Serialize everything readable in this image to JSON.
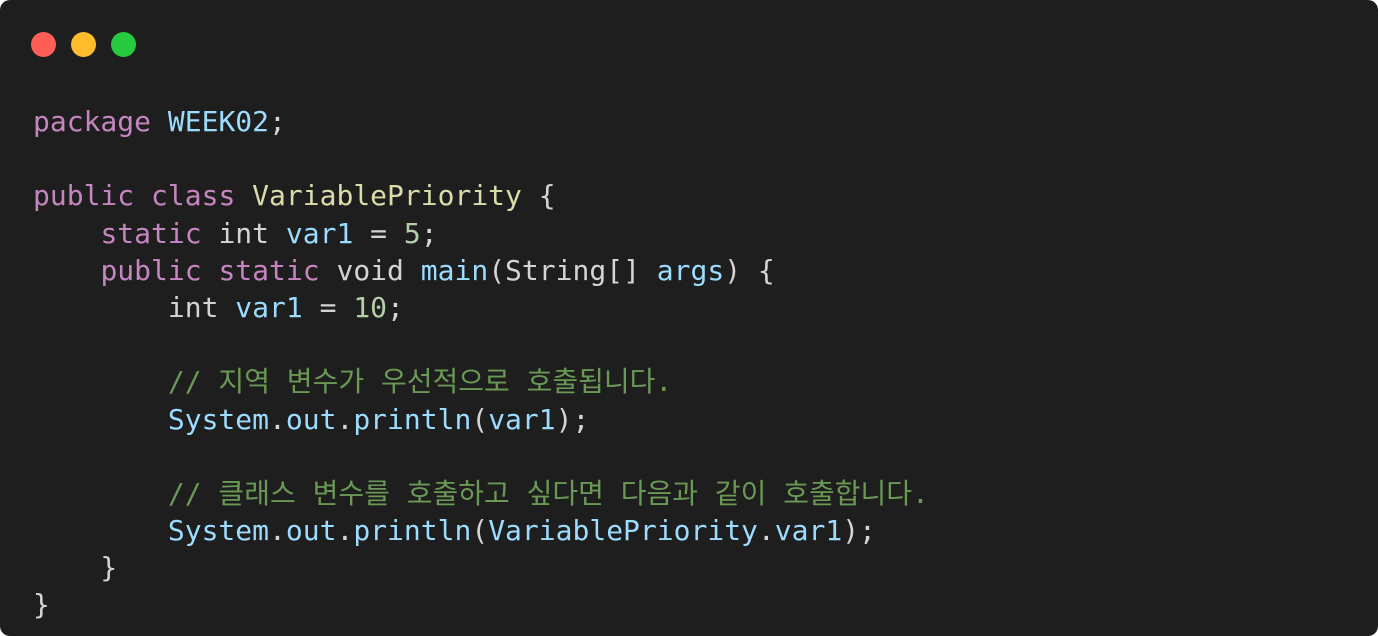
{
  "window": {
    "controls": {
      "close_color": "#ff5f56",
      "minimize_color": "#ffbd2e",
      "maximize_color": "#27c93f"
    }
  },
  "code": {
    "language": "java",
    "lines": [
      [
        {
          "t": "package",
          "c": "kw"
        },
        {
          "t": " ",
          "c": "punc"
        },
        {
          "t": "WEEK02",
          "c": "var"
        },
        {
          "t": ";",
          "c": "punc"
        }
      ],
      [],
      [
        {
          "t": "public",
          "c": "kw"
        },
        {
          "t": " ",
          "c": "punc"
        },
        {
          "t": "class",
          "c": "kw"
        },
        {
          "t": " ",
          "c": "punc"
        },
        {
          "t": "VariablePriority",
          "c": "class"
        },
        {
          "t": " {",
          "c": "punc"
        }
      ],
      [
        {
          "t": "    ",
          "c": "punc"
        },
        {
          "t": "static",
          "c": "kw"
        },
        {
          "t": " ",
          "c": "punc"
        },
        {
          "t": "int",
          "c": "type"
        },
        {
          "t": " ",
          "c": "punc"
        },
        {
          "t": "var1",
          "c": "var"
        },
        {
          "t": " = ",
          "c": "punc"
        },
        {
          "t": "5",
          "c": "num"
        },
        {
          "t": ";",
          "c": "punc"
        }
      ],
      [
        {
          "t": "    ",
          "c": "punc"
        },
        {
          "t": "public",
          "c": "kw"
        },
        {
          "t": " ",
          "c": "punc"
        },
        {
          "t": "static",
          "c": "kw"
        },
        {
          "t": " ",
          "c": "punc"
        },
        {
          "t": "void",
          "c": "type"
        },
        {
          "t": " ",
          "c": "punc"
        },
        {
          "t": "main",
          "c": "fn"
        },
        {
          "t": "(String[] ",
          "c": "punc"
        },
        {
          "t": "args",
          "c": "var"
        },
        {
          "t": ") {",
          "c": "punc"
        }
      ],
      [
        {
          "t": "        ",
          "c": "punc"
        },
        {
          "t": "int",
          "c": "type"
        },
        {
          "t": " ",
          "c": "punc"
        },
        {
          "t": "var1",
          "c": "var"
        },
        {
          "t": " = ",
          "c": "punc"
        },
        {
          "t": "10",
          "c": "num"
        },
        {
          "t": ";",
          "c": "punc"
        }
      ],
      [],
      [
        {
          "t": "        ",
          "c": "punc"
        },
        {
          "t": "// 지역 변수가 우선적으로 호출됩니다.",
          "c": "com"
        }
      ],
      [
        {
          "t": "        ",
          "c": "punc"
        },
        {
          "t": "System",
          "c": "var"
        },
        {
          "t": ".",
          "c": "punc"
        },
        {
          "t": "out",
          "c": "var"
        },
        {
          "t": ".",
          "c": "punc"
        },
        {
          "t": "println",
          "c": "fn"
        },
        {
          "t": "(",
          "c": "punc"
        },
        {
          "t": "var1",
          "c": "var"
        },
        {
          "t": ");",
          "c": "punc"
        }
      ],
      [],
      [
        {
          "t": "        ",
          "c": "punc"
        },
        {
          "t": "// 클래스 변수를 호출하고 싶다면 다음과 같이 호출합니다.",
          "c": "com"
        }
      ],
      [
        {
          "t": "        ",
          "c": "punc"
        },
        {
          "t": "System",
          "c": "var"
        },
        {
          "t": ".",
          "c": "punc"
        },
        {
          "t": "out",
          "c": "var"
        },
        {
          "t": ".",
          "c": "punc"
        },
        {
          "t": "println",
          "c": "fn"
        },
        {
          "t": "(",
          "c": "punc"
        },
        {
          "t": "VariablePriority",
          "c": "var"
        },
        {
          "t": ".",
          "c": "punc"
        },
        {
          "t": "var1",
          "c": "var"
        },
        {
          "t": ");",
          "c": "punc"
        }
      ],
      [
        {
          "t": "    }",
          "c": "punc"
        }
      ],
      [
        {
          "t": "}",
          "c": "punc"
        }
      ]
    ]
  }
}
